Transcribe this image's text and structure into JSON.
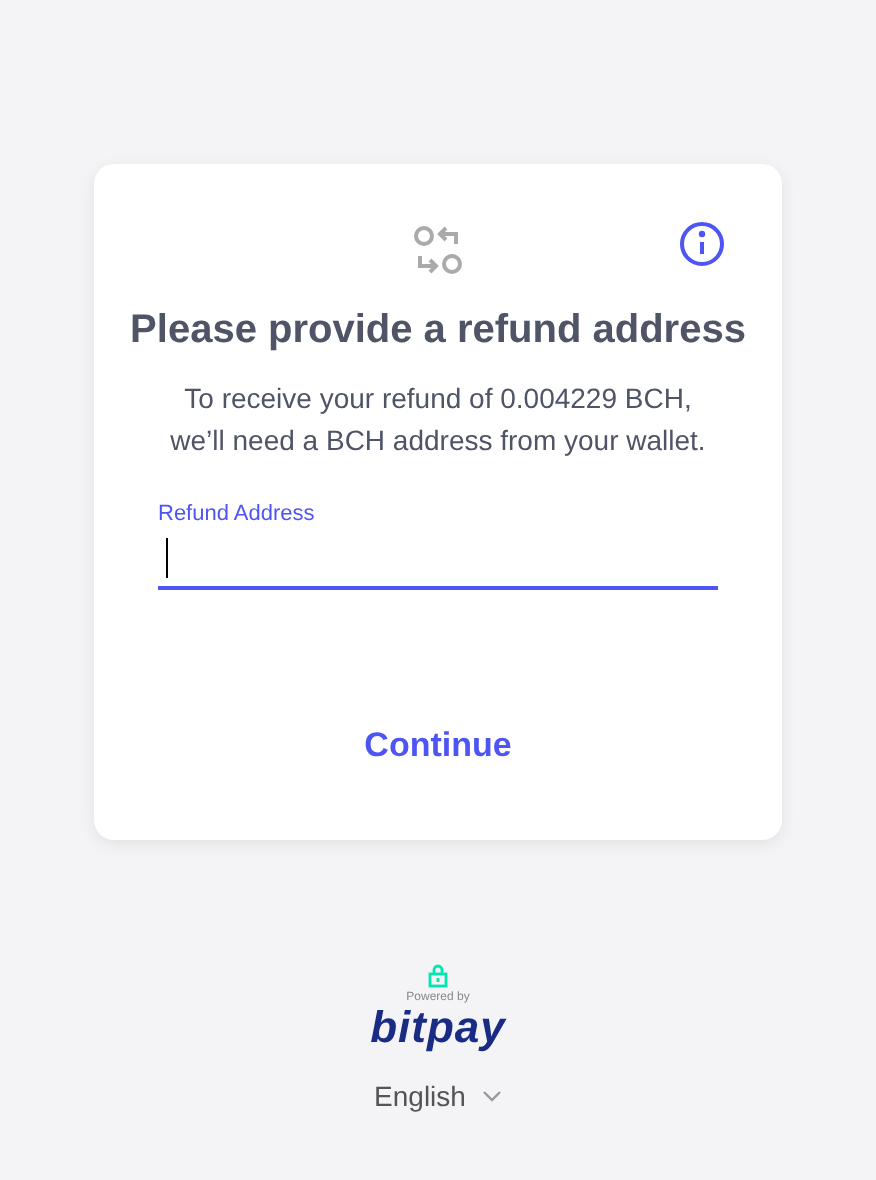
{
  "card": {
    "title": "Please provide a refund address",
    "message": [
      "To receive your refund of 0.004229 BCH,",
      "we’ll need a BCH address from your wallet."
    ],
    "field": {
      "label": "Refund Address",
      "focused": true
    },
    "button": "Continue"
  },
  "footer": {
    "powered_by": "Powered by",
    "brand": "bitpay",
    "language": "English"
  }
}
